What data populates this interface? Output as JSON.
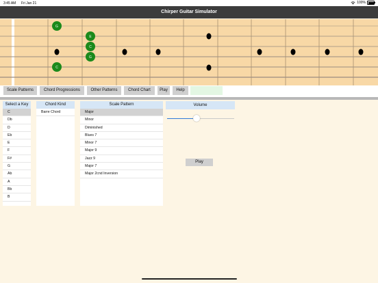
{
  "status_bar": {
    "time": "3:45 AM",
    "date": "Fri Jan 21",
    "battery": "100%"
  },
  "app": {
    "title": "Chirper Guitar Simulator"
  },
  "fretboard": {
    "fret_count": 11,
    "string_count": 6,
    "inlay_dots": [
      {
        "fret": 3,
        "string": 3
      },
      {
        "fret": 5,
        "string": 3
      },
      {
        "fret": 7,
        "string": 3
      },
      {
        "fret": 9,
        "string": 1
      },
      {
        "fret": 9,
        "string": 5
      },
      {
        "fret": 12,
        "string": 3
      },
      {
        "fret": 15,
        "string": 3
      },
      {
        "fret": 17,
        "string": 3
      },
      {
        "fret": 19,
        "string": 3
      }
    ],
    "notes": [
      {
        "label": "G",
        "fret": 3,
        "string": 0
      },
      {
        "label": "E",
        "fret": 5,
        "string": 1
      },
      {
        "label": "C",
        "fret": 5,
        "string": 2
      },
      {
        "label": "G",
        "fret": 5,
        "string": 3
      },
      {
        "label": "C",
        "fret": 3,
        "string": 4
      }
    ],
    "colors": {
      "wood": "#f8d8a6",
      "note": "#1c8a1c",
      "nut": "#ffffff",
      "fret": "#a89070"
    }
  },
  "toolbar": {
    "buttons": [
      {
        "id": "scale-patterns",
        "label": "Scale Patterns"
      },
      {
        "id": "chord-progressions",
        "label": "Chord Progressions"
      },
      {
        "id": "other-patterns",
        "label": "Other Patterns"
      },
      {
        "id": "chord-chart",
        "label": "Chord Chart"
      },
      {
        "id": "play",
        "label": "Play"
      },
      {
        "id": "help",
        "label": "Help"
      }
    ]
  },
  "key_panel": {
    "header": "Select a Key",
    "items": [
      "C",
      "Db",
      "D",
      "Eb",
      "E",
      "F",
      "F#",
      "G",
      "Ab",
      "A",
      "Bb",
      "B"
    ],
    "selected": "C"
  },
  "chord_panel": {
    "header": "Chord Kind",
    "items": [
      "Barre Chord"
    ]
  },
  "scale_panel": {
    "header": "Scale Pattern",
    "items": [
      "Major",
      "Minor",
      "Diminished",
      "Blues 7",
      "Minor 7",
      "Major 9",
      "Jazz 9",
      "Major 7",
      "Major 2cnd Inversion"
    ],
    "selected": "Major"
  },
  "volume": {
    "label": "Volume",
    "level": 0.44
  },
  "play_button": {
    "label": "Play"
  }
}
